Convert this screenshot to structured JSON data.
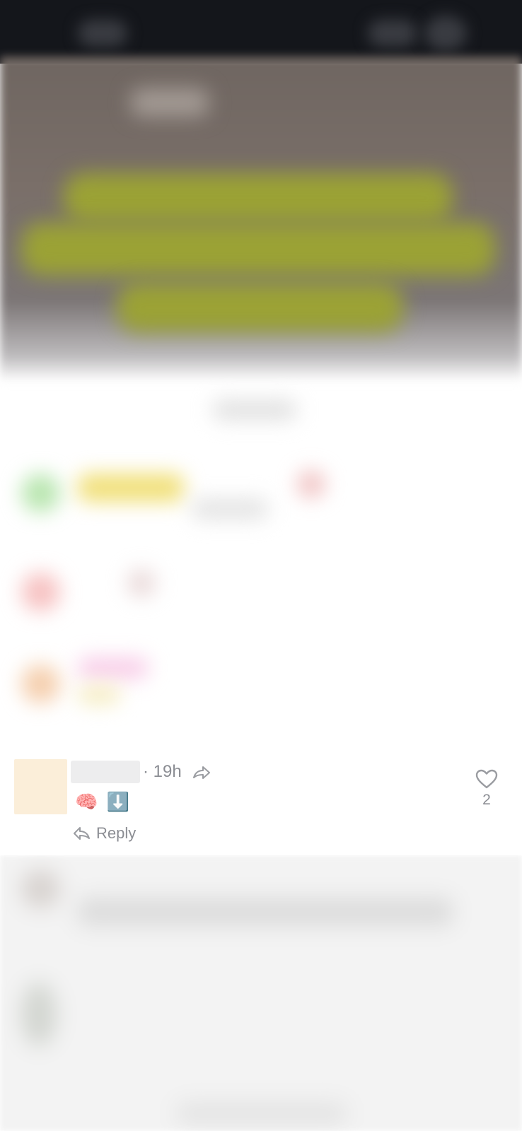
{
  "comment": {
    "time": "· 19h",
    "content_emojis": [
      "🧠",
      "⬇️"
    ],
    "reply_label": "Reply",
    "like_count": "2",
    "icons": {
      "share": "share-arrow-icon",
      "reply": "reply-arrow-icon",
      "like": "heart-outline-icon"
    },
    "colors": {
      "meta_text": "#8b8d93",
      "avatar_bg": "#fbeed9"
    }
  }
}
